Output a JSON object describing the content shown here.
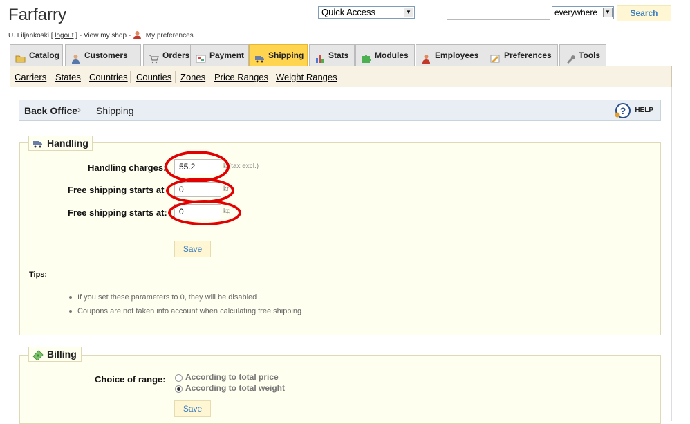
{
  "header": {
    "shop_name": "Farfarry",
    "user_name": "U. Liljankoski",
    "bracket_open": "[",
    "logout": "logout",
    "bracket_close_sep": "] -",
    "view_shop": "View my shop",
    "dash": "-",
    "my_preferences": "My preferences",
    "quick_access": "Quick Access",
    "search_scope": "everywhere",
    "search_value": "",
    "search_button": "Search"
  },
  "tabs": [
    {
      "label": "Catalog",
      "icon": "folder-icon",
      "active": false
    },
    {
      "label": "Customers",
      "icon": "user-icon",
      "active": false
    },
    {
      "label": "Orders",
      "icon": "cart-icon",
      "active": false
    },
    {
      "label": "Payment",
      "icon": "payment-icon",
      "active": false
    },
    {
      "label": "Shipping",
      "icon": "truck-icon",
      "active": true
    },
    {
      "label": "Stats",
      "icon": "bar-chart-icon",
      "active": false
    },
    {
      "label": "Modules",
      "icon": "puzzle-icon",
      "active": false
    },
    {
      "label": "Employees",
      "icon": "employee-icon",
      "active": false
    },
    {
      "label": "Preferences",
      "icon": "settings-icon",
      "active": false
    },
    {
      "label": "Tools",
      "icon": "wrench-icon",
      "active": false
    }
  ],
  "subnav": [
    "Carriers",
    "States",
    "Countries",
    "Counties",
    "Zones",
    "Price Ranges",
    "Weight Ranges"
  ],
  "breadcrumb": {
    "home": "Back Office",
    "separator": "›",
    "current": "Shipping",
    "help": "HELP"
  },
  "handling": {
    "legend": "Handling",
    "fields": [
      {
        "label": "Handling charges:",
        "value": "55.2",
        "unit": "k (tax excl.)"
      },
      {
        "label": "Free shipping starts at",
        "value": "0",
        "unit": "kr"
      },
      {
        "label": "Free shipping starts at:",
        "value": "0",
        "unit": "kg"
      }
    ],
    "save": "Save",
    "tips_title": "Tips:",
    "tips": [
      "If you set these parameters to 0, they will be disabled",
      "Coupons are not taken into account when calculating free shipping"
    ]
  },
  "billing": {
    "legend": "Billing",
    "label": "Choice of range:",
    "options": [
      {
        "label": "According to total price",
        "checked": false
      },
      {
        "label": "According to total weight",
        "checked": true
      }
    ],
    "save": "Save"
  },
  "colors": {
    "active_tab": "#ffd54f",
    "annotation_ring": "#e30000",
    "button_text": "#3b7fc4"
  }
}
